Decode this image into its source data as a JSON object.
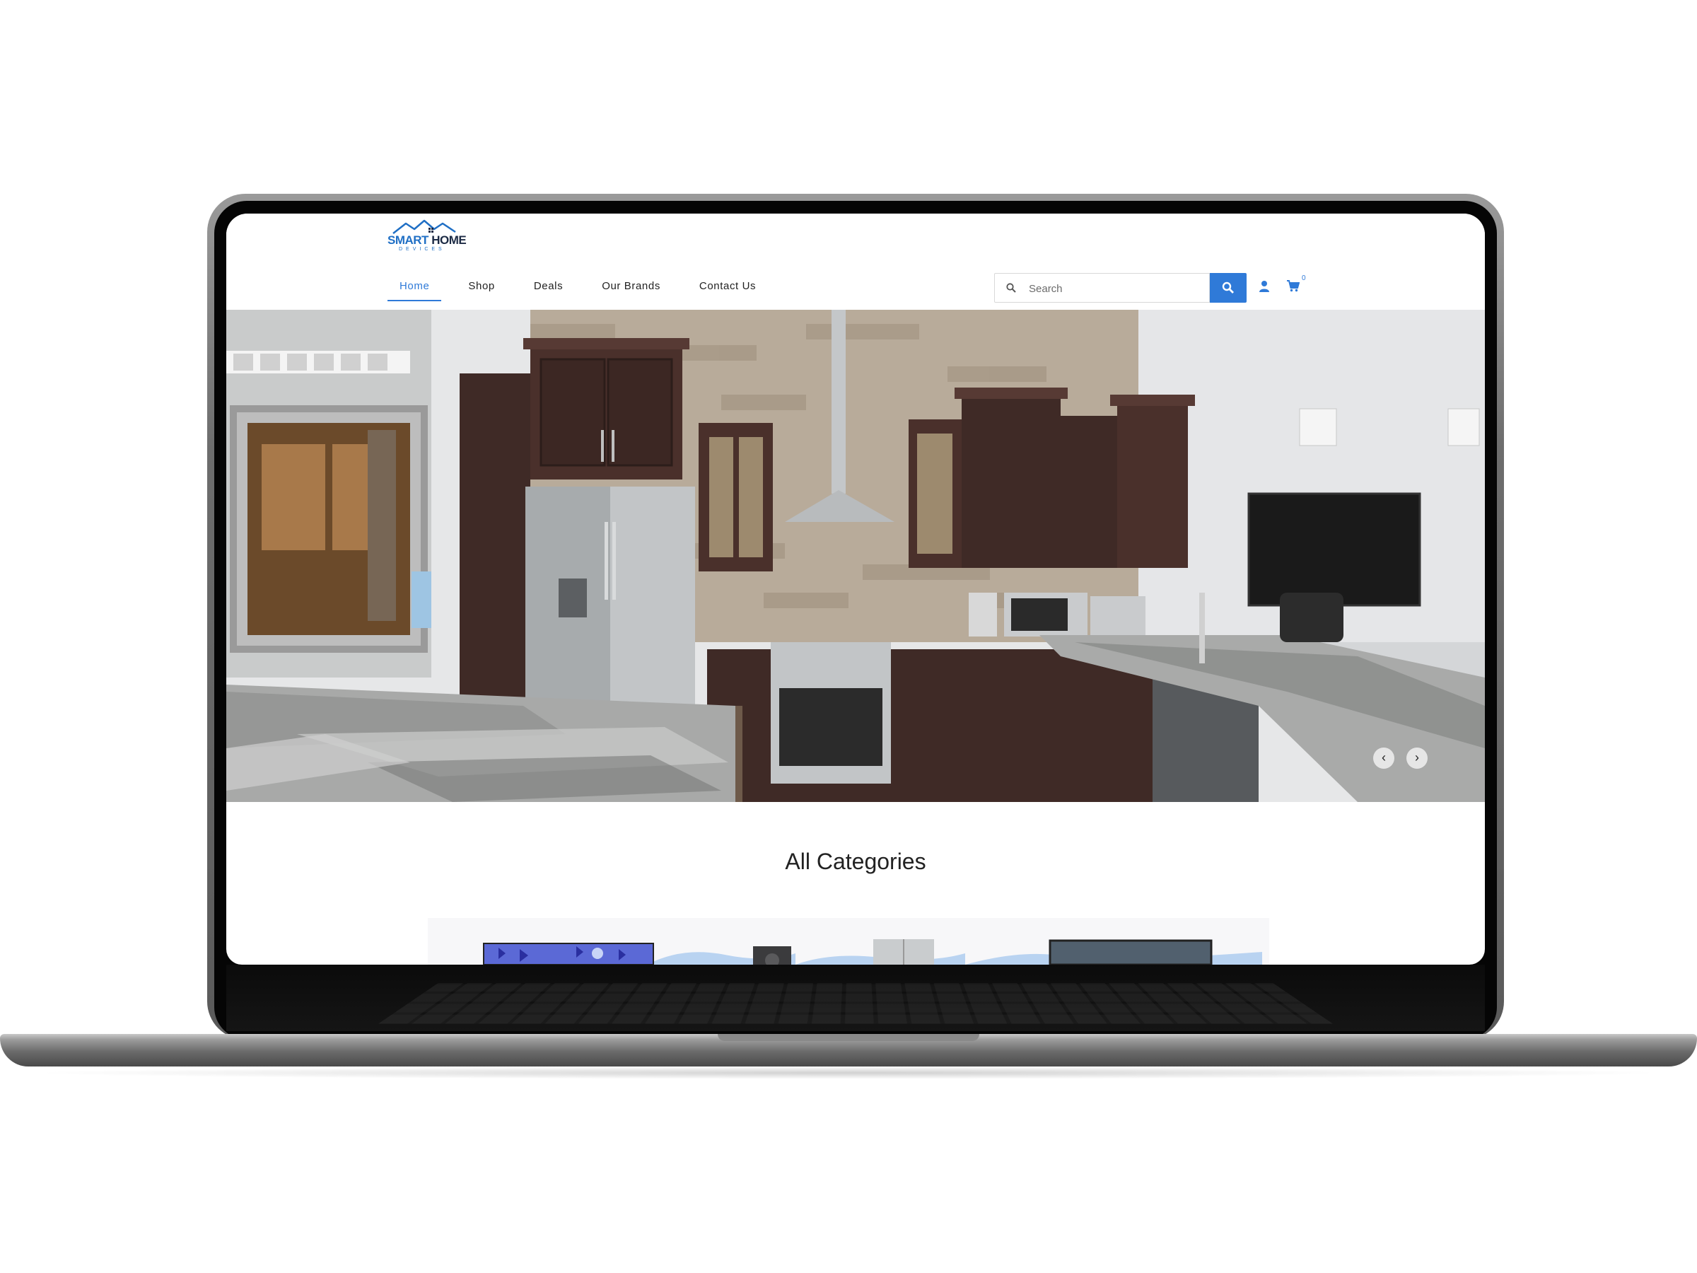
{
  "brand": {
    "logo_main": "SMART",
    "logo_home": "HOME",
    "logo_sub": "DEVICES"
  },
  "nav": {
    "items": [
      {
        "label": "Home",
        "active": true
      },
      {
        "label": "Shop"
      },
      {
        "label": "Deals"
      },
      {
        "label": "Our Brands"
      },
      {
        "label": "Contact Us"
      }
    ]
  },
  "search": {
    "placeholder": "Search",
    "value": ""
  },
  "cart": {
    "count": "0"
  },
  "icons": {
    "search": "search-icon",
    "user": "user-icon",
    "cart": "cart-icon",
    "prev": "chevron-left-icon",
    "next": "chevron-right-icon"
  },
  "hero": {
    "prev_arrow": "‹",
    "next_arrow": "›"
  },
  "sections": {
    "categories_title": "All Categories"
  },
  "colors": {
    "accent": "#2f7ad8",
    "logo_blue": "#1f6fc5",
    "logo_dark": "#1c2a44"
  }
}
